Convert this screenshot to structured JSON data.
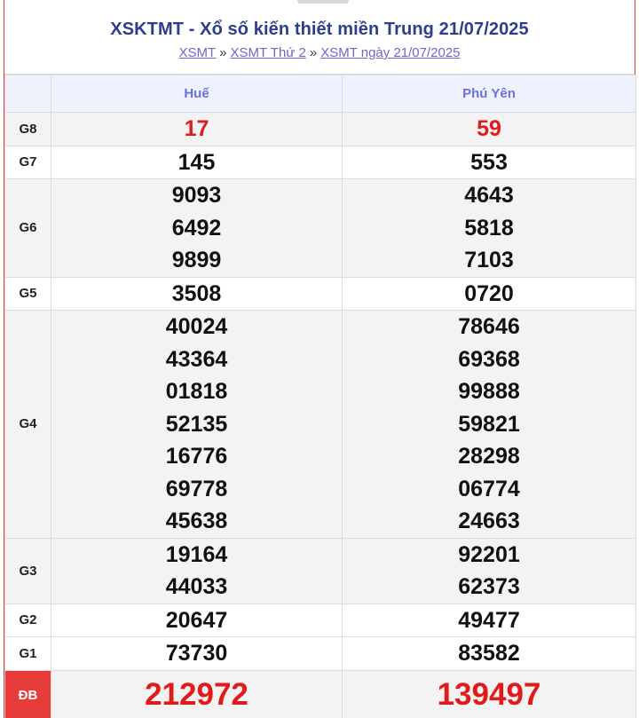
{
  "header": {
    "title": "XSKTMT - Xổ số kiến thiết miền Trung 21/07/2025",
    "breadcrumb": [
      {
        "label": "XSMT"
      },
      {
        "label": "XSMT Thứ 2"
      },
      {
        "label": "XSMT ngày 21/07/2025"
      }
    ],
    "separator": "»"
  },
  "table": {
    "columns": [
      "Huế",
      "Phú Yên"
    ],
    "prizes": [
      {
        "label": "G8",
        "hue": [
          "17"
        ],
        "phuyen": [
          "59"
        ]
      },
      {
        "label": "G7",
        "hue": [
          "145"
        ],
        "phuyen": [
          "553"
        ]
      },
      {
        "label": "G6",
        "hue": [
          "9093",
          "6492",
          "9899"
        ],
        "phuyen": [
          "4643",
          "5818",
          "7103"
        ]
      },
      {
        "label": "G5",
        "hue": [
          "3508"
        ],
        "phuyen": [
          "0720"
        ]
      },
      {
        "label": "G4",
        "hue": [
          "40024",
          "43364",
          "01818",
          "52135",
          "16776",
          "69778",
          "45638"
        ],
        "phuyen": [
          "78646",
          "69368",
          "99888",
          "59821",
          "28298",
          "06774",
          "24663"
        ]
      },
      {
        "label": "G3",
        "hue": [
          "19164",
          "44033"
        ],
        "phuyen": [
          "92201",
          "62373"
        ]
      },
      {
        "label": "G2",
        "hue": [
          "20647"
        ],
        "phuyen": [
          "49477"
        ]
      },
      {
        "label": "G1",
        "hue": [
          "73730"
        ],
        "phuyen": [
          "83582"
        ]
      },
      {
        "label": "ĐB",
        "hue": [
          "212972"
        ],
        "phuyen": [
          "139497"
        ]
      }
    ]
  },
  "colors": {
    "title": "#2c3f8c",
    "link": "#6f66c9",
    "highlight_number": "#e01b1b",
    "special_prize_bg": "#e83b3b",
    "column_header": "#6a72d8"
  }
}
